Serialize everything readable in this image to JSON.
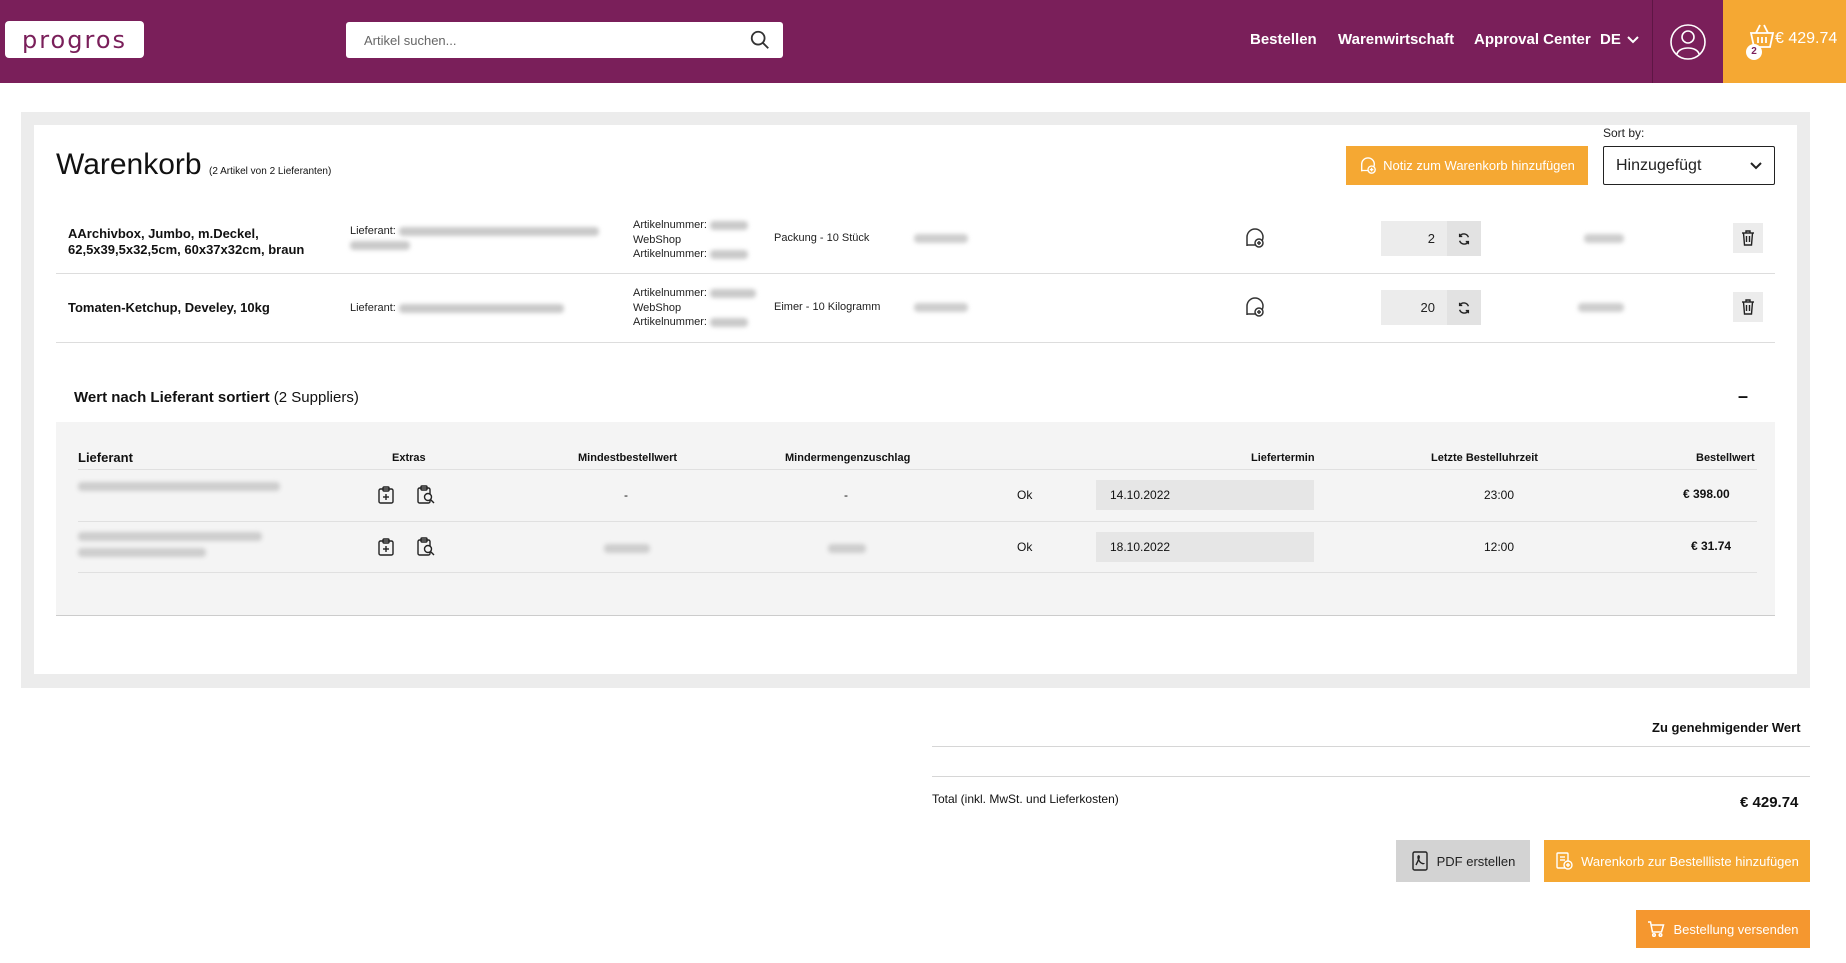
{
  "header": {
    "logo": "progros",
    "search_placeholder": "Artikel suchen...",
    "nav": [
      "Bestellen",
      "Warenwirtschaft",
      "Approval Center"
    ],
    "language": "DE",
    "cart_count": "2",
    "cart_total": "€ 429.74"
  },
  "cart": {
    "title": "Warenkorb",
    "subtitle": "(2 Artikel von 2 Lieferanten)",
    "note_button": "Notiz zum Warenkorb hinzufügen",
    "sort_label": "Sort by:",
    "sort_value": "Hinzugefügt",
    "items": [
      {
        "name_line1": "AArchivbox, Jumbo, m.Deckel,",
        "name_line2": "62,5x39,5x32,5cm, 60x37x32cm, braun",
        "supplier_label": "Lieferant:",
        "art_label": "Artikelnummer:",
        "webshop_label": "WebShop",
        "webshop_art_label": "Artikelnummer:",
        "packaging": "Packung - 10 Stück",
        "quantity": "2"
      },
      {
        "name_line1": "Tomaten-Ketchup, Develey, 10kg",
        "supplier_label": "Lieferant:",
        "art_label": "Artikelnummer:",
        "webshop_label": "WebShop",
        "webshop_art_label": "Artikelnummer:",
        "packaging": "Eimer - 10 Kilogramm",
        "quantity": "20"
      }
    ]
  },
  "suppliers": {
    "title_bold": "Wert nach Lieferant sortiert",
    "title_rest": "(2 Suppliers)",
    "collapse": "–",
    "columns": {
      "supplier": "Lieferant",
      "extras": "Extras",
      "min_order": "Mindestbestellwert",
      "min_surcharge": "Mindermengenzuschlag",
      "delivery": "Liefertermin",
      "last_time": "Letzte Bestelluhrzeit",
      "order_value": "Bestellwert"
    },
    "rows": [
      {
        "min_order": "-",
        "min_surcharge": "-",
        "status": "Ok",
        "delivery": "14.10.2022",
        "last_time": "23:00",
        "value": "€ 398.00"
      },
      {
        "status": "Ok",
        "delivery": "18.10.2022",
        "last_time": "12:00",
        "value": "€ 31.74"
      }
    ]
  },
  "footer": {
    "approve_label": "Zu genehmigender Wert",
    "total_label": "Total (inkl. MwSt. und Lieferkosten)",
    "total_value": "€ 429.74",
    "pdf_button": "PDF erstellen",
    "add_list_button": "Warenkorb zur Bestellliste hinzufügen",
    "send_button": "Bestellung versenden"
  },
  "colors": {
    "brand": "#7a1f5a",
    "accent": "#f5a833"
  }
}
